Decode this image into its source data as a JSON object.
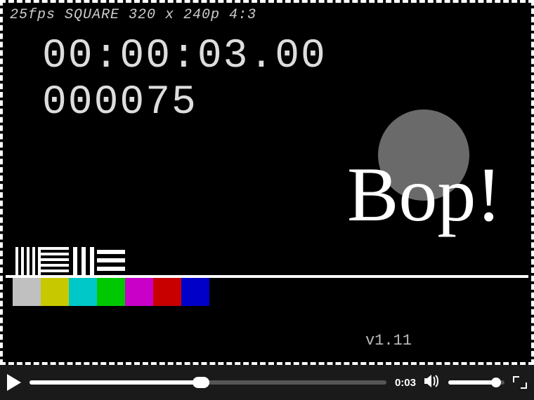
{
  "video": {
    "spec": "25fps SQUARE 320 x 240p 4:3",
    "timecode": "00:00:03.00",
    "framecount": "000075",
    "bop": "Bop!",
    "version": "v1.11",
    "colorbars": [
      "#c0c0c0",
      "#c8c800",
      "#00c8c8",
      "#00c800",
      "#c800c8",
      "#c80000",
      "#0000c8"
    ]
  },
  "controls": {
    "time": "0:03",
    "progress_pct": 48,
    "volume_pct": 85
  }
}
